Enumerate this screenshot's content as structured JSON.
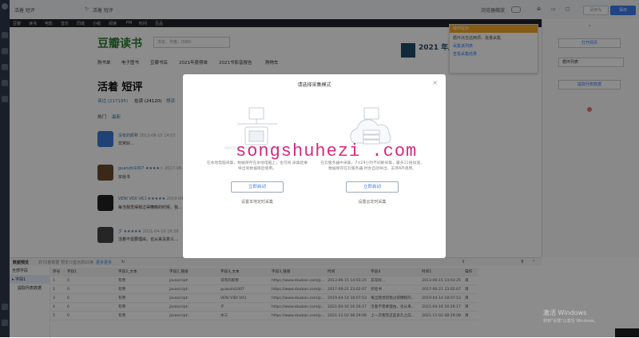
{
  "window": {
    "tab_title": "活着 短评",
    "page_title_bar": "活着 短评",
    "toolbar_buttons": [
      "另存为",
      "保存"
    ],
    "zoom_label": "浏览器缩放"
  },
  "browser_nav": [
    "豆瓣",
    "读书",
    "电影",
    "音乐",
    "同城",
    "小组",
    "阅读",
    "FM",
    "时间",
    "豆品"
  ],
  "site": {
    "logo": "豆瓣读书",
    "search_placeholder": "书名、作者、ISBN",
    "nav": [
      "购书单",
      "电子图书",
      "豆瓣书店",
      "2021年度榜单",
      "2021书影音报告",
      "购物车"
    ],
    "banner": "2021 年度读书榜单",
    "page_heading": "活着 短评",
    "tabs": [
      "读过 (217195)",
      "在读 (24120)",
      "想读"
    ],
    "sort": [
      "热门",
      "最新"
    ]
  },
  "reviews": [
    {
      "user": "没有的昵称",
      "date": "2013-06-15 14:03",
      "text": "非常好..."
    },
    {
      "user": "guanzhi1007 ★★★★☆",
      "date": "2017-06-21",
      "text": "买给书"
    },
    {
      "user": "VENI VIDI VICI ★★★★★",
      "date": "2019-04-14",
      "text": "每当我觉得我过得糟糕的时候，我..."
    },
    {
      "user": "夕 ★★★★★",
      "date": "2021-04-16 16:26",
      "text": "活着不需要理由，也从来没意义..."
    }
  ],
  "right_panel": {
    "tip_header": "操作提示",
    "tip_lines": [
      "循环点击这两项，批量采集",
      "采集该列表",
      "查看采集结果"
    ],
    "buttons": [
      "打开网页",
      "循环列表",
      "提取列表数据"
    ]
  },
  "modal": {
    "title": "请选择采集模式",
    "close": "×",
    "local": {
      "desc": "在本地电脑采集，数据保存在本地电脑上，也可将 采集结果导出到数据库后使用。",
      "button": "立即启动",
      "sub": "设置本地定时采集"
    },
    "cloud": {
      "desc": "在云服务器中采集，7×24小时不间断采集，最多11倍加速，数据保存在云服务器 时会自动导出，支持API调用。",
      "button": "立即启动",
      "sub": "设置云定时采集"
    }
  },
  "watermark": "songshuhezi .com",
  "bottom": {
    "header_items": [
      "数据预览",
      "共72条数据",
      "预览只显示前10条",
      "更多更多"
    ],
    "tree": [
      "全部字段",
      "▸ 字段1",
      "提取列表数据"
    ],
    "columns": [
      "序号",
      "字段1",
      "字段2_文本",
      "字段2_链接",
      "字段3_文本",
      "字段3_链接",
      "时间",
      "字段4",
      "时间1",
      "操作"
    ],
    "rows": [
      [
        "1",
        "0",
        "有用",
        "javascript:",
        "没有的昵称",
        "https://www.douban.com/p...",
        "2013-06-15 14:03:25",
        "非常好...",
        "2013-06-15 14:03:25",
        "目"
      ],
      [
        "2",
        "0",
        "有用",
        "javascript:",
        "guanzhi1007",
        "https://www.douban.com/p...",
        "2017-06-21 23:02:07",
        "买给书",
        "2017-06-21 23:02:07",
        "目"
      ],
      [
        "3",
        "0",
        "有用",
        "javascript:",
        "VENI VIDI VICI",
        "https://www.douban.com/p...",
        "2019-04-14 18:07:53",
        "每当我觉得我过得糟糕的...",
        "2019-04-14 18:07:53",
        "目"
      ],
      [
        "4",
        "0",
        "有用",
        "javascript:",
        "夕",
        "https://www.douban.com/p...",
        "2021-04-16 16:26:17",
        "活着不需要理由，也从来...",
        "2021-04-16 16:26:17",
        "目"
      ],
      [
        "5",
        "0",
        "有用",
        "javascript:",
        "木三",
        "https://www.douban.com/p...",
        "2021-11-02 08:29:08",
        "上一次看完这是多久之前...",
        "2021-11-02 08:29:08",
        "目"
      ]
    ]
  },
  "os": {
    "activate_title": "激活 Windows",
    "activate_sub": "转到\"设置\"以激活 Windows。"
  }
}
